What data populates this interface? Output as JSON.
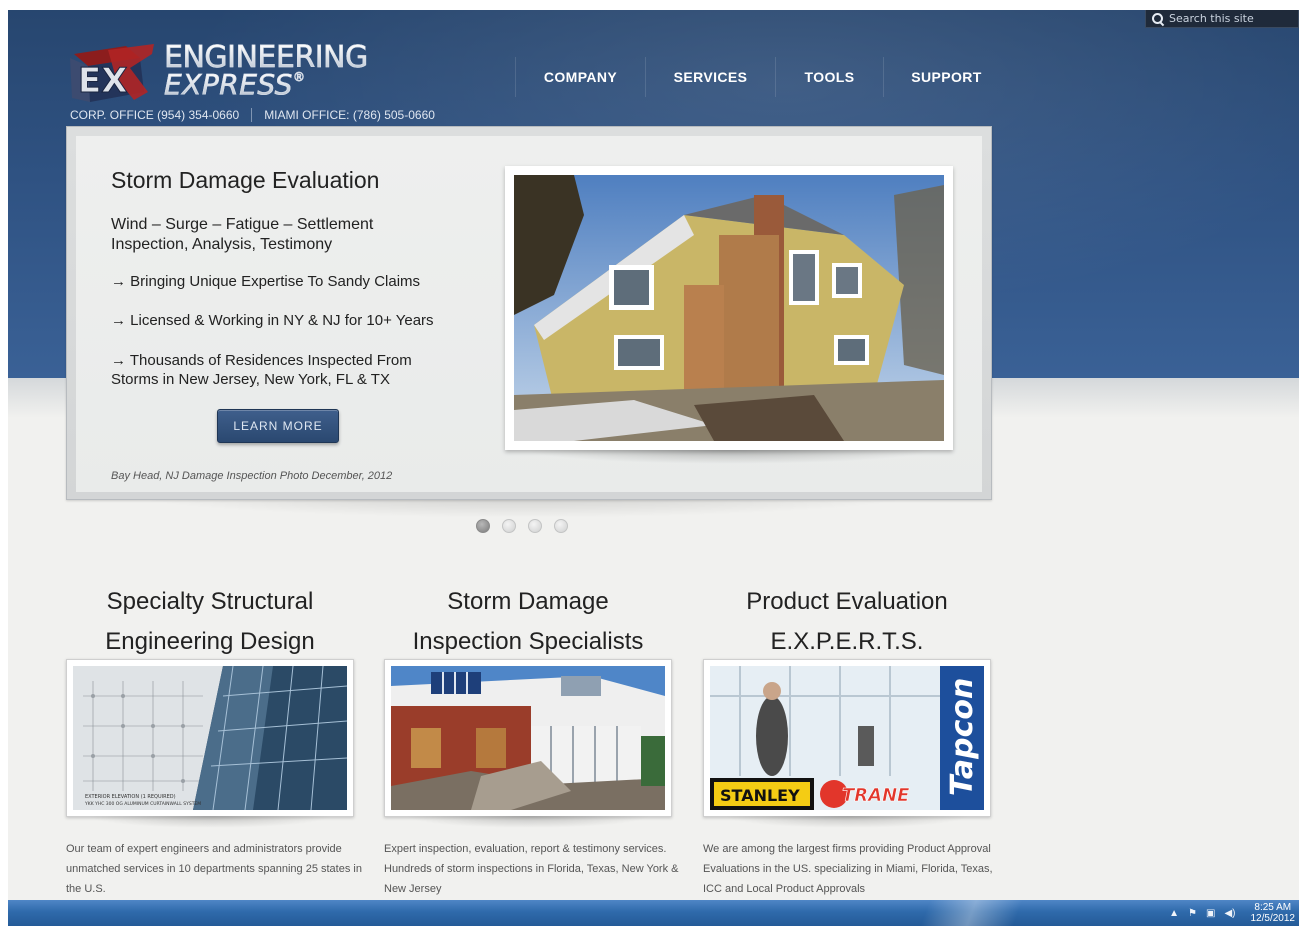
{
  "search": {
    "placeholder": "Search this site"
  },
  "header": {
    "logo_line1": "ENGINEERING",
    "logo_line2": "EXPRESS",
    "logo_reg": "®",
    "logo_mark_letters": "EX",
    "corp_office": "CORP. OFFICE (954) 354-0660",
    "miami_office": "MIAMI OFFICE: (786) 505-0660"
  },
  "nav": {
    "items": [
      {
        "label": "COMPANY"
      },
      {
        "label": "SERVICES"
      },
      {
        "label": "TOOLS"
      },
      {
        "label": "SUPPORT"
      }
    ]
  },
  "slider": {
    "title": "Storm Damage Evaluation",
    "subtitle": "Wind – Surge – Fatigue – Settlement Inspection, Analysis, Testimony",
    "bullet1": "→ Bringing Unique Expertise To Sandy Claims",
    "bullet2": "→ Licensed & Working in NY & NJ for 10+ Years",
    "bullet3": "→ Thousands of Residences Inspected From Storms in New Jersey, New York, FL & TX",
    "button_label": "LEARN MORE",
    "caption": "Bay Head, NJ Damage Inspection Photo December, 2012",
    "dots_count": 4,
    "active_dot": 0
  },
  "features": [
    {
      "title_line1": "Specialty Structural",
      "title_line2": "Engineering Design",
      "image_label1": "EXTERIOR ELEVATION (1 REQUIRED)",
      "image_label2": "YKK YHC 300 OG ALUMINUM CURTAINWALL SYSTEM",
      "text": "Our team of expert engineers and administrators provide unmatched services in 10 departments spanning 25 states in the U.S."
    },
    {
      "title_line1": "Storm Damage",
      "title_line2": "Inspection Specialists",
      "text": "Expert inspection, evaluation, report & testimony services.  Hundreds of storm inspections in Florida, Texas, New York & New Jersey"
    },
    {
      "title_line1": "Product Evaluation",
      "title_line2": "E.X.P.E.R.T.S.",
      "brand1": "STANLEY",
      "brand2": "TRANE",
      "brand3": "Tapcon",
      "text": "We are among the largest firms providing Product Approval Evaluations in the US. specializing in Miami, Florida, Texas, ICC and Local Product Approvals"
    }
  ],
  "taskbar": {
    "time": "8:25 AM",
    "date": "12/5/2012"
  },
  "colors": {
    "header_blue": "#2f5282",
    "button_blue": "#2a4870",
    "taskbar_blue": "#2f6aab"
  }
}
